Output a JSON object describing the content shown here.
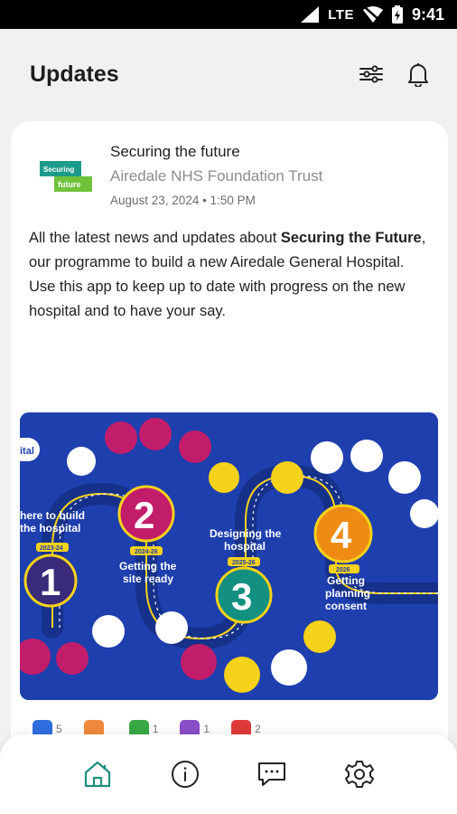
{
  "status_bar": {
    "network": "LTE",
    "time": "9:41"
  },
  "header": {
    "title": "Updates",
    "filter_icon": "sliders-icon",
    "notifications_icon": "bell-icon"
  },
  "post": {
    "logo_text_line1": "Securing",
    "logo_text_line2": "the",
    "logo_text_line3": "future",
    "title": "Securing the future",
    "organisation": "Airedale NHS Foundation Trust",
    "date": "August 23, 2024 • 1:50 PM",
    "body_part1": "All the latest news and updates about ",
    "body_bold": "Securing the Future",
    "body_part2": ", our programme to build a new Airedale General Hospital.",
    "body_part3": "Use this app to keep up to date with progress on the new hospital and to have your say."
  },
  "infographic": {
    "edge_label": "ital",
    "steps": [
      {
        "number": "1",
        "label_line1": "here to build",
        "label_line2": "the hospital",
        "date": "2023-24"
      },
      {
        "number": "2",
        "label_line1": "Getting the",
        "label_line2": "site ready",
        "date": "2024-26"
      },
      {
        "number": "3",
        "label_line1": "Designing the",
        "label_line2": "hospital",
        "date": "2025-26"
      },
      {
        "number": "4",
        "label_line1": "Getting",
        "label_line2": "planning",
        "label_line3": "consent",
        "date": "2026"
      }
    ]
  },
  "reactions": [
    {
      "icon": "thumbs-up-icon",
      "count": "5",
      "color": "#2f6fe0"
    },
    {
      "icon": "heart-icon",
      "count": "",
      "color": "#f08a3c"
    },
    {
      "icon": "lightbulb-icon",
      "count": "1",
      "color": "#3aa845"
    },
    {
      "icon": "smile-icon",
      "count": "1",
      "color": "#8a4fc9"
    },
    {
      "icon": "celebrate-icon",
      "count": "2",
      "color": "#e03a3a"
    }
  ],
  "bottom_nav": [
    {
      "name": "home",
      "icon": "home-icon",
      "active": true
    },
    {
      "name": "info",
      "icon": "info-icon"
    },
    {
      "name": "messages",
      "icon": "chat-icon"
    },
    {
      "name": "settings",
      "icon": "gear-icon"
    }
  ],
  "colors": {
    "accent": "#1d8f7f",
    "infographic_bg": "#1e3fae",
    "step1": "#3a2a7a",
    "step2": "#c21d6b",
    "step3": "#13907f",
    "step4": "#ef8a12",
    "highlight": "#f6d21a"
  }
}
